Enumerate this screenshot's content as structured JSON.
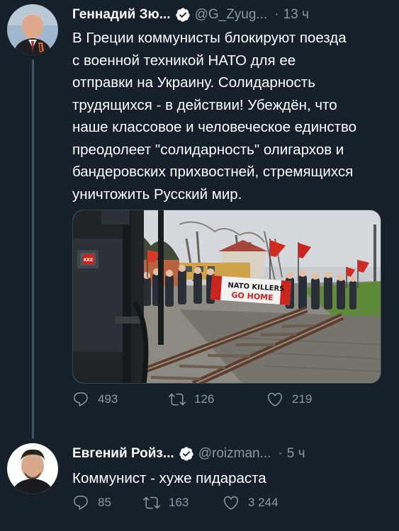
{
  "tweets": [
    {
      "name": "Геннадий Зю...",
      "handle": "@G_Zyug...",
      "time": "13 ч",
      "lines": [
        "В Греции коммунисты блокируют поезда",
        "с военной техникой НАТО для ее",
        "отправки на Украину. Солидарность",
        "трудящихся - в действии! Убеждён, что",
        "наше классовое и человеческое единство",
        "преодолеет \"солидарность\" олигархов и",
        "бандеровских прихвостней, стремящихся",
        "уничтожить Русский мир."
      ],
      "media": {
        "banner_line1": "NATO KILLERS",
        "banner_line2": "GO HOME",
        "flag_label": "KKE"
      },
      "replies": "493",
      "retweets": "126",
      "likes": "219"
    },
    {
      "name": "Евгений Ройз...",
      "handle": "@roizman...",
      "time": "5 ч",
      "lines": [
        "Коммунист - хуже пидараста"
      ],
      "replies": "85",
      "retweets": "163",
      "likes": "3 244"
    }
  ],
  "icons": {
    "reply": "reply-icon",
    "retweet": "retweet-icon",
    "like": "heart-icon",
    "verified": "verified-badge-icon"
  },
  "colors": {
    "background": "#15202b",
    "secondary_text": "#8899a6",
    "verified_badge": "#ffffff",
    "thread_line": "#3d5466"
  }
}
